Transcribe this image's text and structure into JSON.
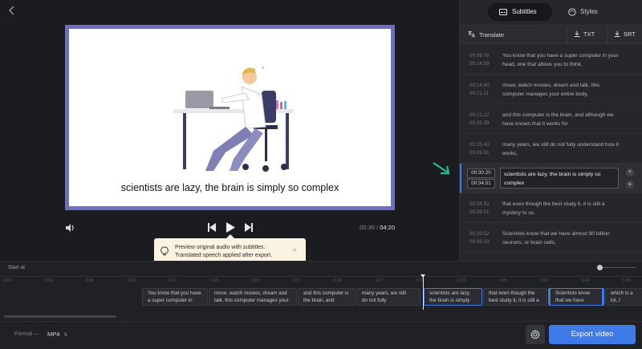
{
  "stage": {
    "caption": "scientists are lazy, the brain is simply so complex",
    "time_current": "00:30",
    "time_separator": "/",
    "time_total": "04:20"
  },
  "tooltip": {
    "line1": "Preview original audio with subtitles.",
    "line2": "Translated speech applied after export.",
    "close": "×"
  },
  "panel": {
    "tabs": [
      {
        "label": "Subtitles",
        "icon": "subtitles-icon",
        "active": true
      },
      {
        "label": "Styles",
        "icon": "palette-icon",
        "active": false
      }
    ],
    "toolbar": {
      "translate": "Translate",
      "txt": "TXT",
      "srt": "SRT"
    },
    "subtitles": [
      {
        "start": "00:09:76",
        "end": "00:14.59",
        "text": "You know that you have a super computer in your head, one that allows you to think,"
      },
      {
        "start": "00:14.60",
        "end": "00:21.11",
        "text": "move, watch movies, dream and talk, this computer manages your entire body,"
      },
      {
        "start": "00:21.12",
        "end": "00:25.39",
        "text": "and this computer is the brain, and although we have known that it works for"
      },
      {
        "start": "00:25.40",
        "end": "00:29.91",
        "text": "many years, we still do not fully understand how it works,"
      },
      {
        "start": "00:30.20",
        "end": "00:34.51",
        "text": "scientists are lazy, the brain is simply so complex"
      },
      {
        "start": "00:34.52",
        "end": "00:39.51",
        "text": "that even though the best study it, it is still a mystery to us."
      },
      {
        "start": "00:39.52",
        "end": "00:43.19",
        "text": "Scientists know that we have almost 90 billion neurons, or brain cells,"
      }
    ]
  },
  "timeline": {
    "start_at": "Start at",
    "ticks": [
      "0:00",
      "0:03",
      "0:06",
      "0:09",
      "0:12",
      "0:15",
      "0:18",
      "0:21",
      "0:24",
      "0:27",
      "0:30",
      "0:33",
      "0:36",
      "0:39",
      "0:42",
      "0:45"
    ],
    "clips": [
      {
        "line1": "You know that you have",
        "line2": "a super computer in"
      },
      {
        "line1": "move, watch movies, dream and",
        "line2": "talk, this computer manages your"
      },
      {
        "line1": "and this computer is",
        "line2": "the brain, and"
      },
      {
        "line1": "many years, we still",
        "line2": "do not fully"
      },
      {
        "line1": "scientists are lazy,",
        "line2": "the brain is simply"
      },
      {
        "line1": "that even though the",
        "line2": "best study it, it is still a"
      },
      {
        "line1": "Scientists know",
        "line2": "that we have"
      },
      {
        "line1": "which is a lot, t",
        "line2": "is"
      }
    ]
  },
  "bottom": {
    "format_label": "Format —",
    "format_value": "MP4",
    "export_label": "Export video"
  },
  "colors": {
    "accent": "#3f7be8",
    "arrow": "#1fbf8f",
    "frame": "#6b6fc5"
  }
}
